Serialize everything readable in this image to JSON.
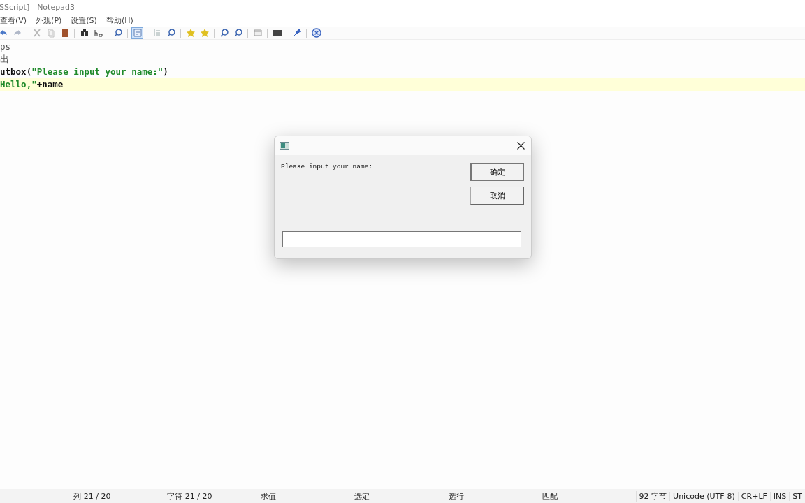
{
  "window": {
    "title": "SScript] - Notepad3"
  },
  "menu": [
    "查看(V)",
    "外观(P)",
    "设置(S)",
    "帮助(H)"
  ],
  "toolbar": [
    {
      "kind": "undo",
      "selected": false
    },
    {
      "kind": "redo",
      "selected": false
    },
    {
      "kind": "sep"
    },
    {
      "kind": "cut",
      "selected": false
    },
    {
      "kind": "copy",
      "selected": false
    },
    {
      "kind": "paste",
      "selected": false
    },
    {
      "kind": "sep"
    },
    {
      "kind": "find",
      "selected": false
    },
    {
      "kind": "replace",
      "selected": false
    },
    {
      "kind": "sep"
    },
    {
      "kind": "search",
      "selected": false
    },
    {
      "kind": "sep"
    },
    {
      "kind": "wrap",
      "selected": true
    },
    {
      "kind": "sep"
    },
    {
      "kind": "list",
      "selected": false
    },
    {
      "kind": "search",
      "selected": false
    },
    {
      "kind": "sep"
    },
    {
      "kind": "star",
      "selected": false
    },
    {
      "kind": "star",
      "selected": false
    },
    {
      "kind": "sep"
    },
    {
      "kind": "zoom",
      "selected": false
    },
    {
      "kind": "zoom",
      "selected": false
    },
    {
      "kind": "sep"
    },
    {
      "kind": "window",
      "selected": false
    },
    {
      "kind": "sep"
    },
    {
      "kind": "monitor",
      "selected": false
    },
    {
      "kind": "sep"
    },
    {
      "kind": "pin",
      "selected": false
    },
    {
      "kind": "sep"
    },
    {
      "kind": "close",
      "selected": false
    }
  ],
  "editor": {
    "lines": [
      {
        "current": false,
        "segments": [
          {
            "kind": "plain",
            "text": "ps"
          }
        ]
      },
      {
        "current": false,
        "segments": [
          {
            "kind": "plain",
            "text": "出"
          }
        ]
      },
      {
        "current": false,
        "segments": [
          {
            "kind": "keyword",
            "text": "utbox("
          },
          {
            "kind": "string",
            "text": "\"Please input your name:\""
          },
          {
            "kind": "keyword",
            "text": ")"
          }
        ]
      },
      {
        "current": true,
        "segments": [
          {
            "kind": "string",
            "text": "Hello,\""
          },
          {
            "kind": "keyword",
            "text": "+name"
          }
        ]
      }
    ]
  },
  "dialog": {
    "message": "Please input your name:",
    "buttons": [
      "确定",
      "取消"
    ]
  },
  "status_bar": {
    "cells": [
      "列 21 / 20",
      "字符 21 / 20",
      "求值 --",
      "选定 --",
      "选行 --",
      "匹配 --"
    ],
    "right": [
      "92 字节",
      "Unicode (UTF-8)",
      "CR+LF",
      "INS",
      "ST"
    ]
  }
}
